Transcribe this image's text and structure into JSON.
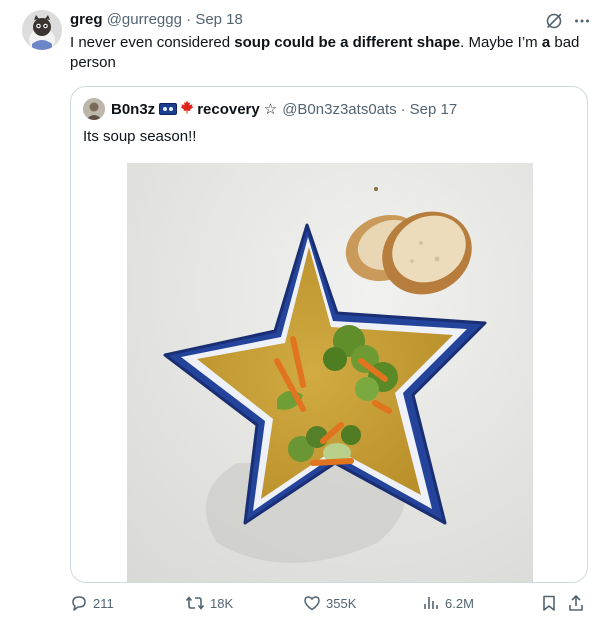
{
  "tweet": {
    "author_name": "greg",
    "author_handle": "@gurreggg",
    "separator": "·",
    "date": "Sep 18",
    "text_before": "I never even considered ",
    "text_bold": "soup could be a different shape",
    "text_middle": ". Maybe I’m ",
    "text_bold2": "a",
    "text_after": " bad person"
  },
  "quote": {
    "author_name": "B0n3z",
    "author_label": "recovery",
    "author_handle": "@B0n3z3ats0ats",
    "separator": "·",
    "date": "Sep 17",
    "text": "Its soup season!!",
    "image_alt": "star-shaped blue bowl of broccoli cheddar soup with bread"
  },
  "actions": {
    "replies": "211",
    "reposts": "18K",
    "likes": "355K",
    "views": "6.2M"
  },
  "icons": {
    "grok": "grok-icon",
    "more": "more-icon",
    "reply": "reply-icon",
    "repost": "repost-icon",
    "like": "heart-icon",
    "views": "views-icon",
    "bookmark": "bookmark-icon",
    "share": "share-icon"
  },
  "colors": {
    "text": "#0f1419",
    "muted": "#536471",
    "border": "#cfd9de",
    "bowl_blue": "#2f4fa8",
    "soup": "#c9a23a"
  }
}
